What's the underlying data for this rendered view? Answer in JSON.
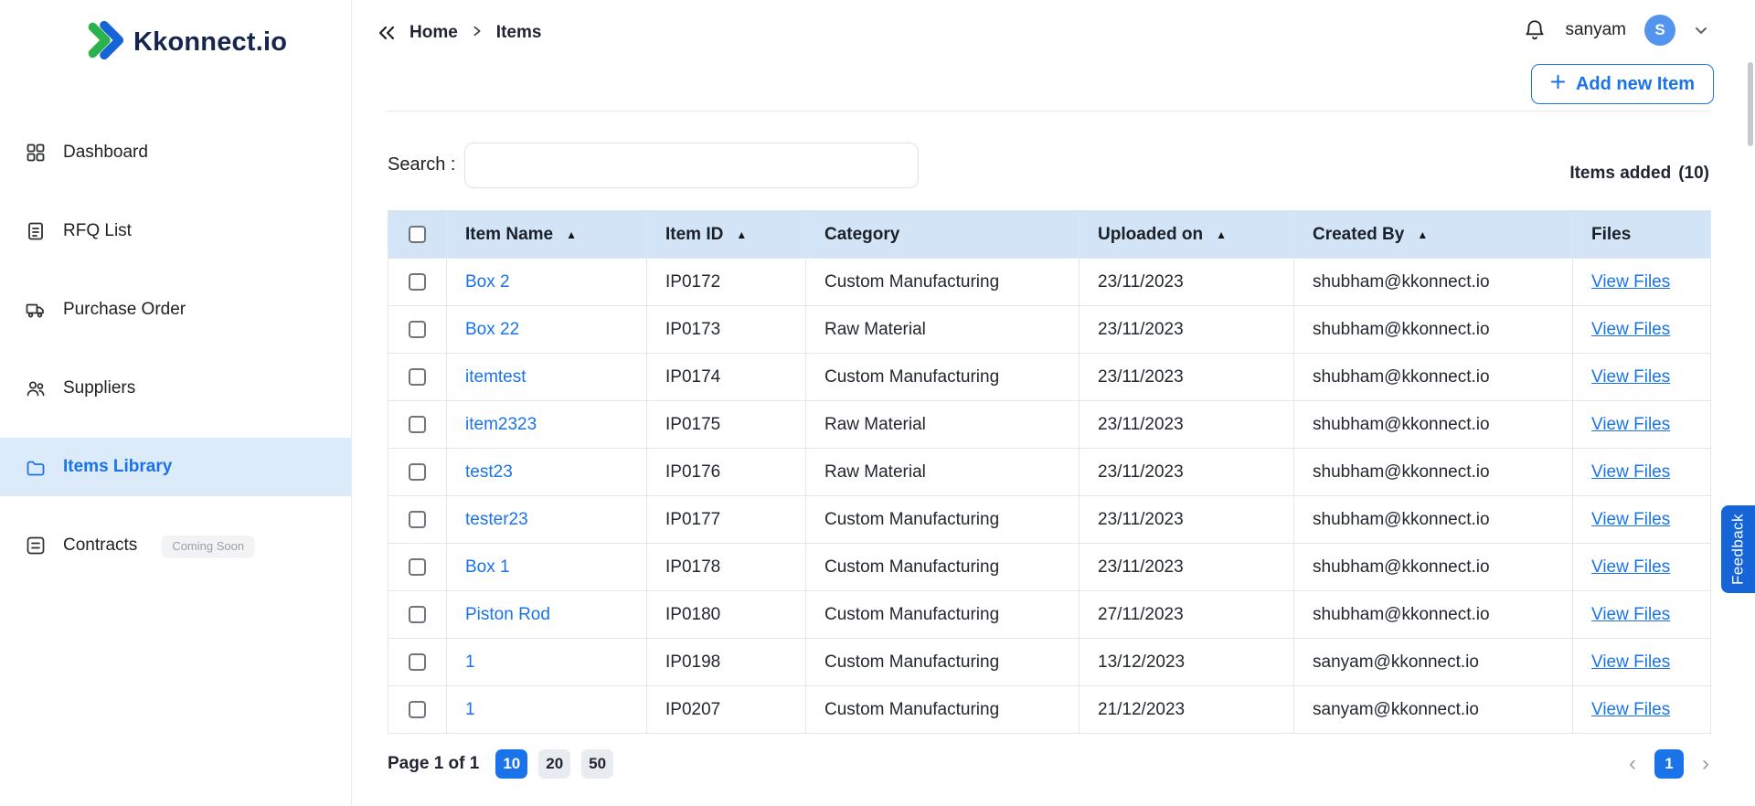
{
  "brand": {
    "name": "Kkonnect.io"
  },
  "sidebar": {
    "items": [
      {
        "label": "Dashboard"
      },
      {
        "label": "RFQ List"
      },
      {
        "label": "Purchase Order"
      },
      {
        "label": "Suppliers"
      },
      {
        "label": "Items Library"
      },
      {
        "label": "Contracts",
        "badge": "Coming Soon"
      }
    ]
  },
  "header": {
    "breadcrumb": {
      "home": "Home",
      "current": "Items"
    },
    "user": {
      "name": "sanyam",
      "initial": "S"
    }
  },
  "toolbar": {
    "add_item": "Add new Item",
    "search_label": "Search :",
    "items_added_label": "Items added",
    "items_added_count": "(10)"
  },
  "table": {
    "sort_glyph": "▲",
    "columns": [
      "Item Name",
      "Item ID",
      "Category",
      "Uploaded on",
      "Created By",
      "Files"
    ],
    "view_files": "View Files",
    "rows": [
      {
        "name": "Box 2",
        "id": "IP0172",
        "category": "Custom Manufacturing",
        "uploaded": "23/11/2023",
        "created_by": "shubham@kkonnect.io"
      },
      {
        "name": "Box 22",
        "id": "IP0173",
        "category": "Raw Material",
        "uploaded": "23/11/2023",
        "created_by": "shubham@kkonnect.io"
      },
      {
        "name": "itemtest",
        "id": "IP0174",
        "category": "Custom Manufacturing",
        "uploaded": "23/11/2023",
        "created_by": "shubham@kkonnect.io"
      },
      {
        "name": "item2323",
        "id": "IP0175",
        "category": "Raw Material",
        "uploaded": "23/11/2023",
        "created_by": "shubham@kkonnect.io"
      },
      {
        "name": "test23",
        "id": "IP0176",
        "category": "Raw Material",
        "uploaded": "23/11/2023",
        "created_by": "shubham@kkonnect.io"
      },
      {
        "name": "tester23",
        "id": "IP0177",
        "category": "Custom Manufacturing",
        "uploaded": "23/11/2023",
        "created_by": "shubham@kkonnect.io"
      },
      {
        "name": "Box 1",
        "id": "IP0178",
        "category": "Custom Manufacturing",
        "uploaded": "23/11/2023",
        "created_by": "shubham@kkonnect.io"
      },
      {
        "name": "Piston Rod",
        "id": "IP0180",
        "category": "Custom Manufacturing",
        "uploaded": "27/11/2023",
        "created_by": "shubham@kkonnect.io"
      },
      {
        "name": "1",
        "id": "IP0198",
        "category": "Custom Manufacturing",
        "uploaded": "13/12/2023",
        "created_by": "sanyam@kkonnect.io"
      },
      {
        "name": "1",
        "id": "IP0207",
        "category": "Custom Manufacturing",
        "uploaded": "21/12/2023",
        "created_by": "sanyam@kkonnect.io"
      }
    ]
  },
  "pagination": {
    "page_label": "Page 1 of 1",
    "sizes": [
      "10",
      "20",
      "50"
    ],
    "current_page": "1",
    "prev_glyph": "‹",
    "next_glyph": "›"
  },
  "feedback_label": "Feedback",
  "colors": {
    "primary": "#1a73e8",
    "table_header_bg": "#d2e4f5",
    "active_nav_bg": "#dcebfa",
    "feedback_bg": "#1565d8"
  }
}
